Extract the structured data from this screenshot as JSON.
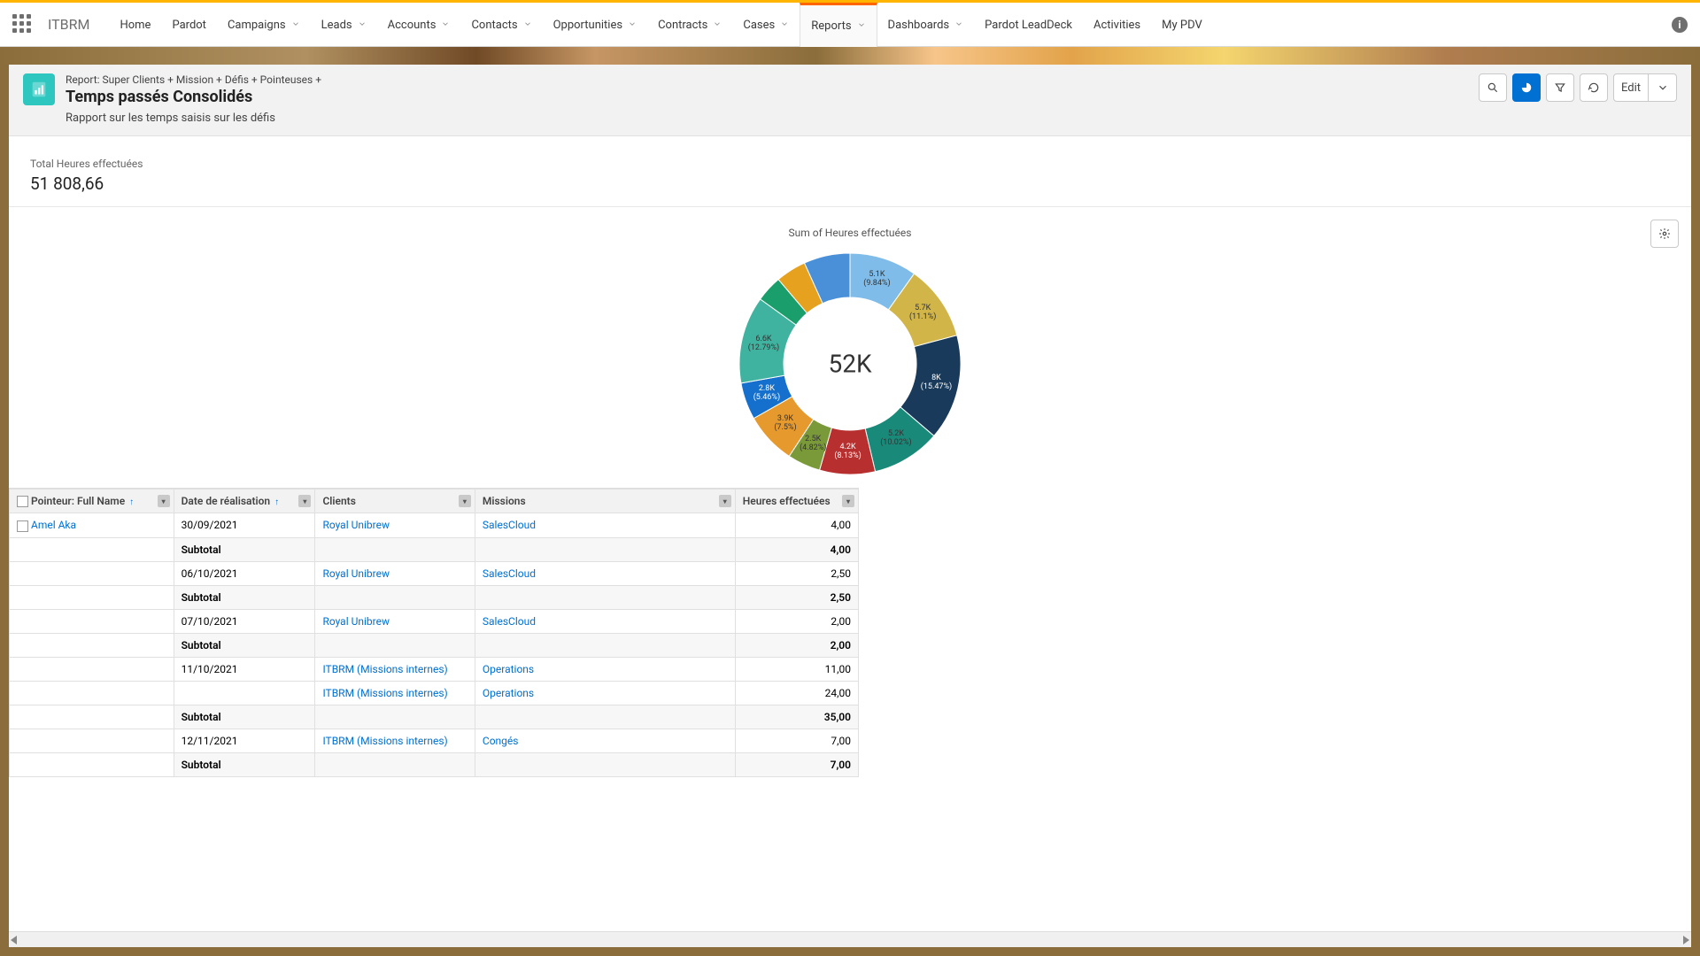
{
  "app_name": "ITBRM",
  "nav": {
    "items": [
      {
        "label": "Home",
        "dd": false
      },
      {
        "label": "Pardot",
        "dd": false
      },
      {
        "label": "Campaigns",
        "dd": true
      },
      {
        "label": "Leads",
        "dd": true
      },
      {
        "label": "Accounts",
        "dd": true
      },
      {
        "label": "Contacts",
        "dd": true
      },
      {
        "label": "Opportunities",
        "dd": true
      },
      {
        "label": "Contracts",
        "dd": true
      },
      {
        "label": "Cases",
        "dd": true
      },
      {
        "label": "Reports",
        "dd": true,
        "active": true
      },
      {
        "label": "Dashboards",
        "dd": true
      },
      {
        "label": "Pardot LeadDeck",
        "dd": false
      },
      {
        "label": "Activities",
        "dd": false
      },
      {
        "label": "My PDV",
        "dd": false
      }
    ]
  },
  "header": {
    "breadcrumb": "Report: Super Clients + Mission + Défis + Pointeuses +",
    "title": "Temps passés Consolidés",
    "subtitle": "Rapport sur les temps saisis sur les défis",
    "edit_label": "Edit"
  },
  "metric": {
    "label": "Total Heures effectuées",
    "value": "51 808,66"
  },
  "chart_data": {
    "type": "pie",
    "title": "Sum of Heures effectuées",
    "center": "52K",
    "series": [
      {
        "label": "5.1K",
        "pct": "9.84%",
        "value": 5100,
        "color": "#7fbce9"
      },
      {
        "label": "5.7K",
        "pct": "11.1%",
        "value": 5700,
        "color": "#d1b548"
      },
      {
        "label": "8K",
        "pct": "15.47%",
        "value": 8000,
        "color": "#193a5a"
      },
      {
        "label": "5.2K",
        "pct": "10.02%",
        "value": 5200,
        "color": "#198a7a"
      },
      {
        "label": "4.2K",
        "pct": "8.13%",
        "value": 4200,
        "color": "#b72f2f"
      },
      {
        "label": "2.5K",
        "pct": "4.82%",
        "value": 2500,
        "color": "#7a9a3a"
      },
      {
        "label": "3.9K",
        "pct": "7.5%",
        "value": 3900,
        "color": "#e69a2e"
      },
      {
        "label": "2.8K",
        "pct": "5.46%",
        "value": 2800,
        "color": "#1570cd"
      },
      {
        "label": "6.6K",
        "pct": "12.79%",
        "value": 6600,
        "color": "#3fb39f"
      },
      {
        "label": "",
        "pct": "",
        "value": 2000,
        "color": "#1a9e6b"
      },
      {
        "label": "",
        "pct": "",
        "value": 2300,
        "color": "#e6a11f"
      },
      {
        "label": "",
        "pct": "",
        "value": 3500,
        "color": "#4a90d9"
      }
    ]
  },
  "table": {
    "columns": [
      {
        "label": "Pointeur: Full Name",
        "sort": true
      },
      {
        "label": "Date de réalisation",
        "sort": true
      },
      {
        "label": "Clients",
        "sort": false
      },
      {
        "label": "Missions",
        "sort": false
      },
      {
        "label": "Heures effectuées",
        "sort": false
      }
    ],
    "pointeur": "Amel Aka",
    "subtotal_label": "Subtotal",
    "rows": [
      {
        "type": "data",
        "date": "30/09/2021",
        "client": "Royal Unibrew",
        "mission": "SalesCloud",
        "hours": "4,00"
      },
      {
        "type": "sub",
        "hours": "4,00"
      },
      {
        "type": "data",
        "date": "06/10/2021",
        "client": "Royal Unibrew",
        "mission": "SalesCloud",
        "hours": "2,50"
      },
      {
        "type": "sub",
        "hours": "2,50"
      },
      {
        "type": "data",
        "date": "07/10/2021",
        "client": "Royal Unibrew",
        "mission": "SalesCloud",
        "hours": "2,00"
      },
      {
        "type": "sub",
        "hours": "2,00"
      },
      {
        "type": "data",
        "date": "11/10/2021",
        "client": "ITBRM (Missions internes)",
        "mission": "Operations",
        "hours": "11,00"
      },
      {
        "type": "data",
        "date": "",
        "client": "ITBRM (Missions internes)",
        "mission": "Operations",
        "hours": "24,00"
      },
      {
        "type": "sub",
        "hours": "35,00"
      },
      {
        "type": "data",
        "date": "12/11/2021",
        "client": "ITBRM (Missions internes)",
        "mission": "Congés",
        "hours": "7,00"
      },
      {
        "type": "sub",
        "hours": "7,00"
      }
    ]
  }
}
